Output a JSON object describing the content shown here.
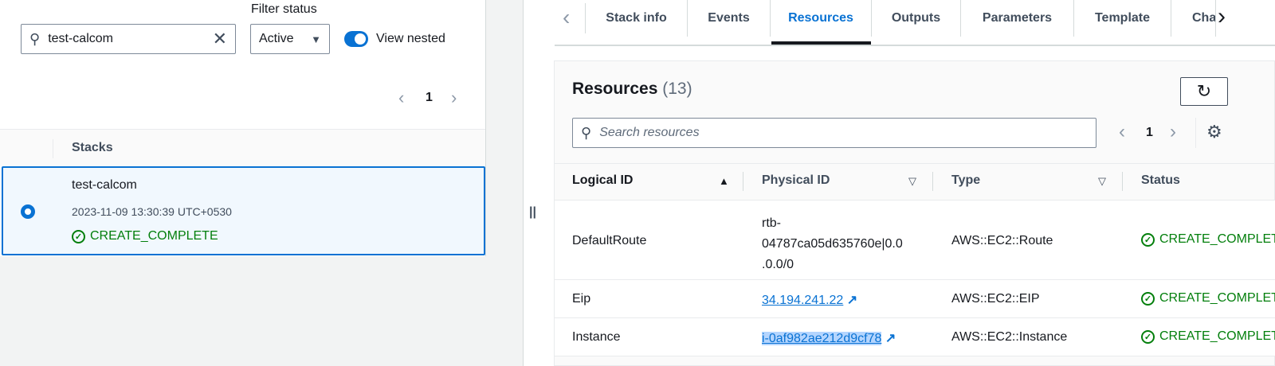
{
  "stacks_panel": {
    "search_value": "test-calcom",
    "filter_label": "Filter status",
    "filter_value": "Active",
    "view_nested_label": "View nested",
    "page": "1",
    "column_header": "Stacks",
    "stacks": [
      {
        "name": "test-calcom",
        "timestamp": "2023-11-09 13:30:39 UTC+0530",
        "status": "CREATE_COMPLETE"
      }
    ]
  },
  "tabs": [
    "Stack info",
    "Events",
    "Resources",
    "Outputs",
    "Parameters",
    "Template",
    "Cha"
  ],
  "active_tab": "Resources",
  "resources": {
    "title": "Resources",
    "count": "(13)",
    "search_placeholder": "Search resources",
    "page": "1",
    "columns": [
      "Logical ID",
      "Physical ID",
      "Type",
      "Status"
    ],
    "rows": [
      {
        "logical_id": "DefaultRoute",
        "physical_id_lines": [
          "rtb-",
          "04787ca05d635760e|0.0",
          ".0.0/0"
        ],
        "type": "AWS::EC2::Route",
        "status": "CREATE_COMPLETE"
      },
      {
        "logical_id": "Eip",
        "physical_id": "34.194.241.22",
        "type": "AWS::EC2::EIP",
        "status": "CREATE_COMPLETE"
      },
      {
        "logical_id": "Instance",
        "physical_id": "i-0af982ae212d9cf78",
        "type": "AWS::EC2::Instance",
        "status": "CREATE_COMPLETE"
      }
    ]
  },
  "colors": {
    "accent": "#0972d3",
    "success": "#037f0c"
  }
}
